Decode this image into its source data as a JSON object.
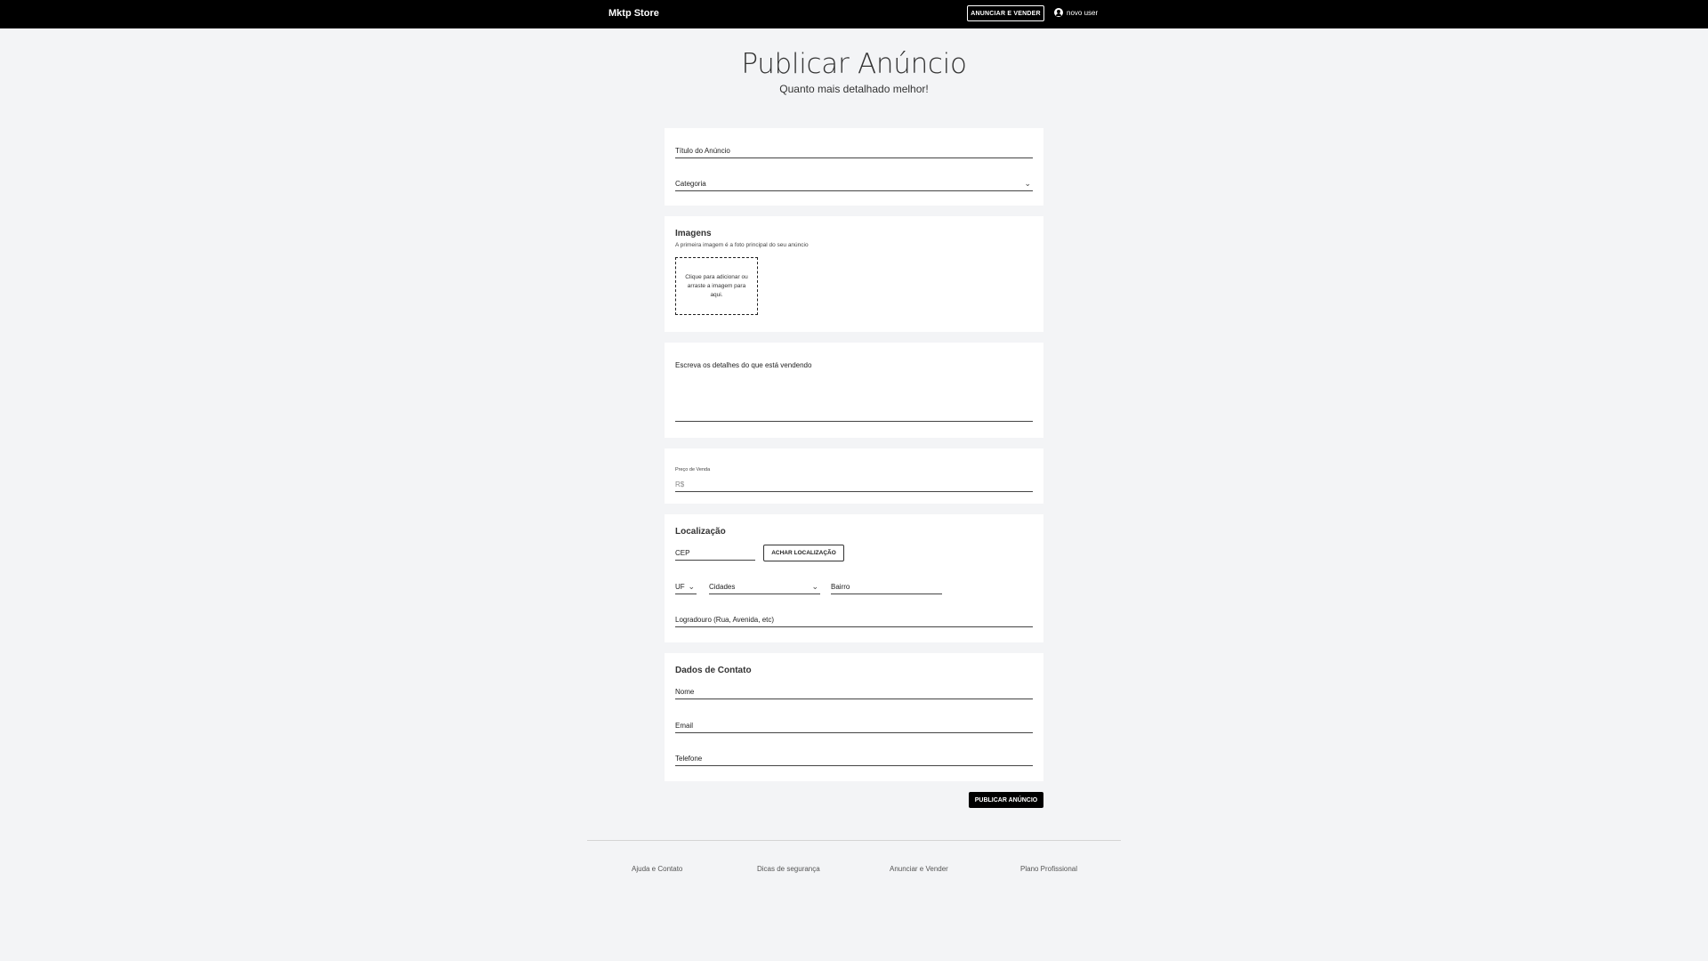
{
  "nav": {
    "brand": "Mktp Store",
    "sell_button": "ANUNCIAR E VENDER",
    "user_name": "novo user"
  },
  "header": {
    "title": "Publicar Anúncio",
    "subtitle": "Quanto mais detalhado melhor!"
  },
  "basic": {
    "title_label": "Título do Anúncio",
    "category_label": "Categoria"
  },
  "images": {
    "heading": "Imagens",
    "hint": "A primeira imagem é a foto principal do seu anúncio",
    "upload_text": "Clique para adicionar ou arraste a imagem para aqui."
  },
  "description": {
    "label": "Escreva os detalhes do que está vendendo"
  },
  "price": {
    "label": "Preço de Venda",
    "prefix": "R$"
  },
  "location": {
    "heading": "Localização",
    "cep_label": "CEP",
    "find_button": "ACHAR LOCALIZAÇÃO",
    "uf_label": "UF",
    "city_label": "Cidades",
    "district_label": "Bairro",
    "street_label": "Logradouro (Rua, Avenida, etc)"
  },
  "contact": {
    "heading": "Dados de Contato",
    "name_label": "Nome",
    "email_label": "Email",
    "phone_label": "Telefone"
  },
  "actions": {
    "publish_button": "PUBLICAR ANÚNCIO"
  },
  "footer": {
    "links": [
      "Ajuda e Contato",
      "Dicas de segurança",
      "Anunciar e Vender",
      "Plano Profissional"
    ]
  }
}
